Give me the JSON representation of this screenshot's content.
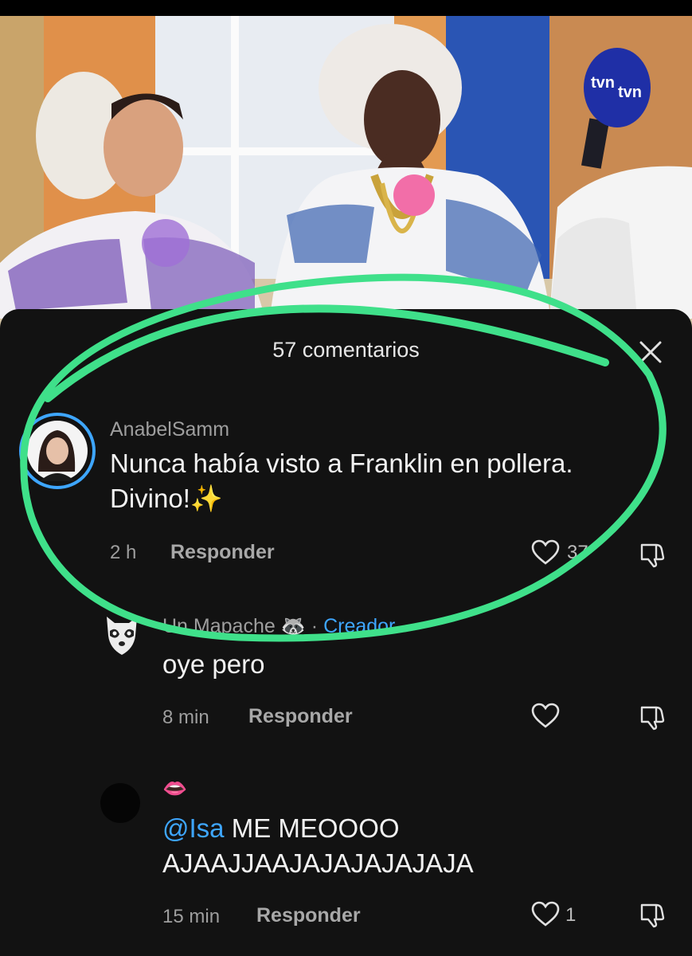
{
  "video": {
    "description": "",
    "mic_logo_text": "tvn"
  },
  "comments_panel": {
    "title": "57 comentarios",
    "close_icon": "close-icon"
  },
  "comments": [
    {
      "username": "AnabelSamm",
      "text": "Nunca había visto a Franklin en pollera. Divino!✨",
      "time": "2 h",
      "reply_label": "Responder",
      "likes": "37",
      "highlighted": true
    },
    {
      "username": "Un Mapache 🦝",
      "creator_separator": "·",
      "creator_label": "Creador",
      "text": "oye pero",
      "time": "8 min",
      "reply_label": "Responder",
      "likes": ""
    },
    {
      "username": "👄",
      "mention": "@Isa",
      "text_line1": " ME MEOOOO",
      "text_line2": "AJAAJJAAJAJAJAJAJAJA",
      "time": "15 min",
      "reply_label": "Responder",
      "likes": "1"
    }
  ],
  "colors": {
    "panel_bg": "#121212",
    "accent_blue": "#3ea6ff",
    "highlight_green": "#3fe08a"
  }
}
